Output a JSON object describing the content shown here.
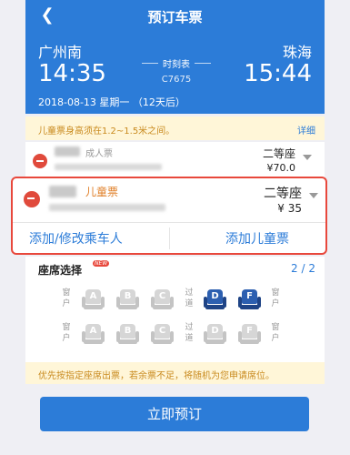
{
  "header": {
    "title": "预订车票",
    "from_station": "广州南",
    "to_station": "珠海",
    "dep_time": "14:35",
    "arr_time": "15:44",
    "schedule_link": "时刻表",
    "train_no": "C7675",
    "date_line": "2018-08-13 星期一 （12天后）"
  },
  "child_notice": {
    "text": "儿童票身高须在1.2~1.5米之间。",
    "link": "详细"
  },
  "passengers": [
    {
      "ticket_type": "成人票",
      "seat_class": "二等座",
      "price": "¥70.0"
    },
    {
      "ticket_type": "儿童票",
      "seat_class": "二等座",
      "price": "¥ 35"
    }
  ],
  "actions": {
    "edit_passengers": "添加/修改乘车人",
    "add_child": "添加儿童票"
  },
  "seat_selection": {
    "title": "座席选择",
    "badge": "NEW",
    "pager": "2 / 2",
    "window_label": "窗户",
    "aisle_label": "过道",
    "row1": [
      "A",
      "B",
      "C",
      "D",
      "F"
    ],
    "row2": [
      "A",
      "B",
      "C",
      "D",
      "F"
    ],
    "selected_row1": [
      "D",
      "F"
    ]
  },
  "footer_notice": "优先按指定座席出票，若余票不足，将随机为您申请席位。",
  "submit_label": "立即预订",
  "colors": {
    "primary": "#2c7cd8",
    "danger": "#e8483c",
    "warning": "#c98a1e"
  }
}
